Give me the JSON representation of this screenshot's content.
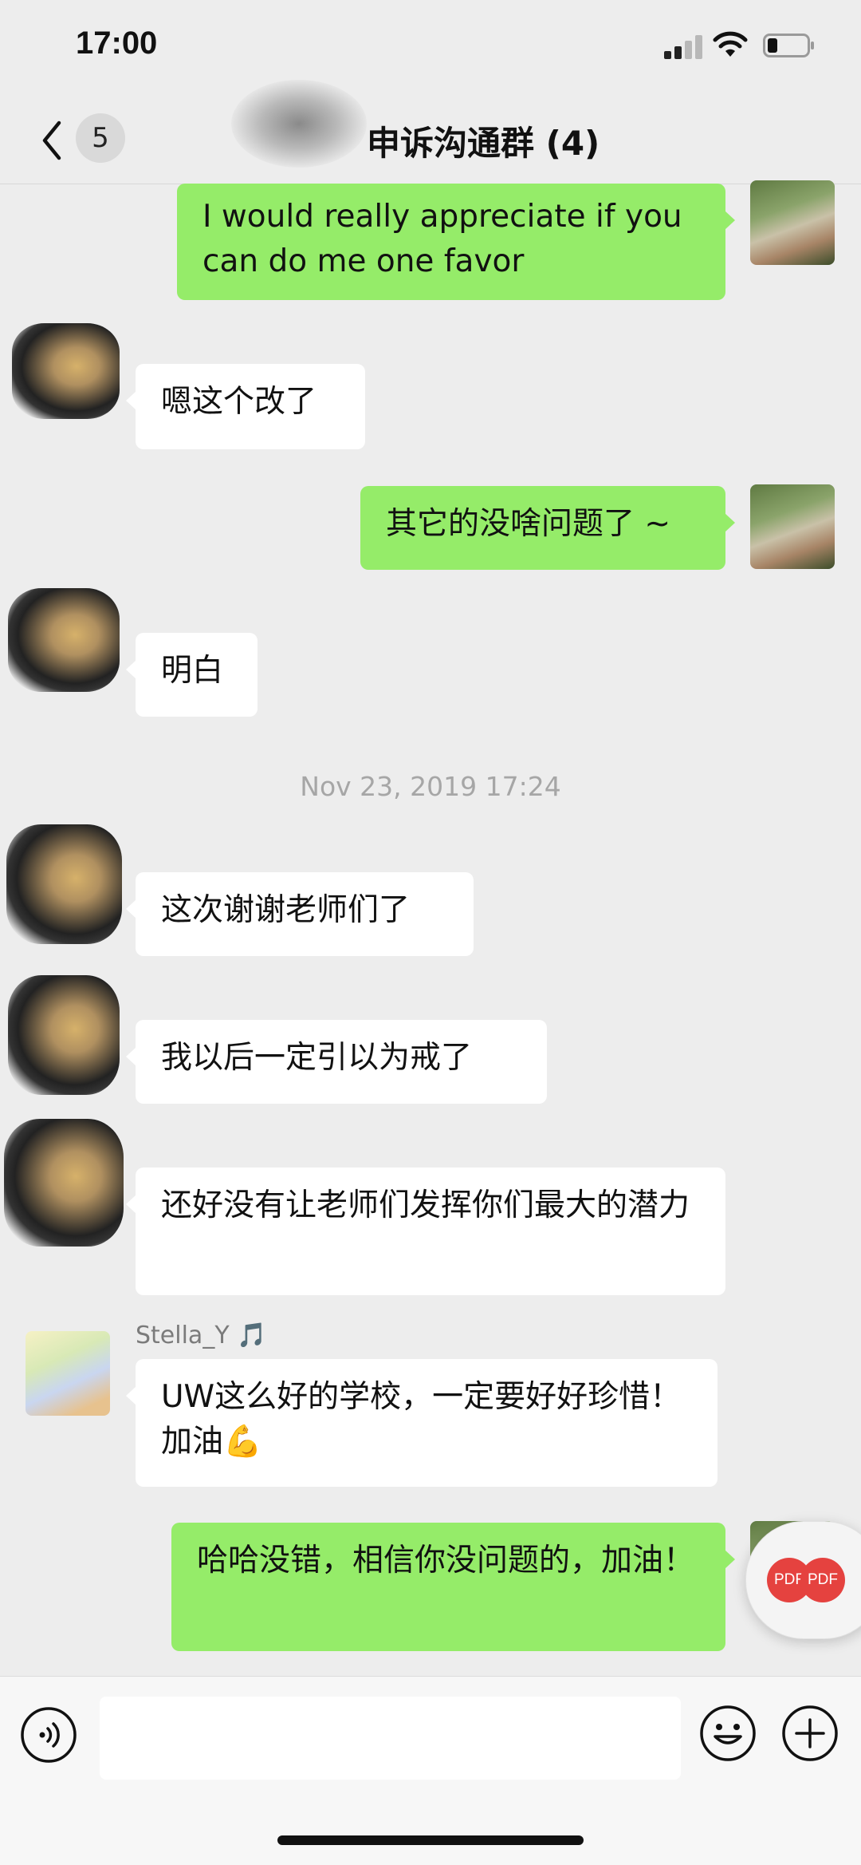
{
  "status_bar": {
    "time": "17:00"
  },
  "header": {
    "back_count": "5",
    "title": "申诉沟通群 (4)"
  },
  "messages": [
    {
      "text": "I would really appreciate if you can do me one favor"
    },
    {
      "text": "嗯这个改了"
    },
    {
      "text": "其它的没啥问题了 ~"
    },
    {
      "text": "明白"
    },
    {
      "text": "这次谢谢老师们了"
    },
    {
      "text": "我以后一定引以为戒了"
    },
    {
      "text": "还好没有让老师们发挥你们最大的潜力"
    },
    {
      "text": "UW这么好的学校，一定要好好珍惜！加油💪"
    },
    {
      "text": "哈哈没错，相信你没问题的，加油！"
    }
  ],
  "timestamp": "Nov 23, 2019 17:24",
  "sender_name": "Stella_Y 🎵",
  "floating_files": [
    {
      "label": "PDF"
    },
    {
      "label": "PDF"
    }
  ],
  "colors": {
    "outgoing_bubble": "#95ec69",
    "incoming_bubble": "#ffffff",
    "background": "#ededed"
  }
}
